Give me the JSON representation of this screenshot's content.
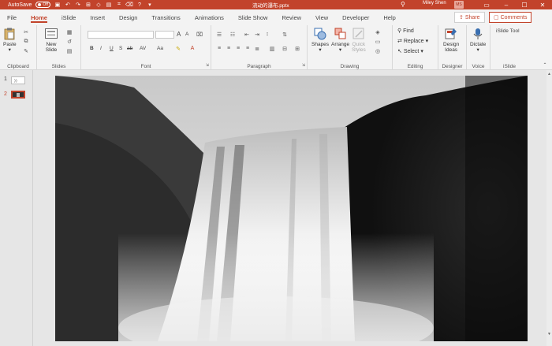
{
  "titlebar": {
    "autosave_label": "AutoSave",
    "autosave_state": "Off",
    "doc_title": "流动的瀑布.pptx",
    "user_name": "Miley Shen",
    "user_initials": "MS"
  },
  "tabs": [
    {
      "label": "File"
    },
    {
      "label": "Home"
    },
    {
      "label": "iSlide"
    },
    {
      "label": "Insert"
    },
    {
      "label": "Design"
    },
    {
      "label": "Transitions"
    },
    {
      "label": "Animations"
    },
    {
      "label": "Slide Show"
    },
    {
      "label": "Review"
    },
    {
      "label": "View"
    },
    {
      "label": "Developer"
    },
    {
      "label": "Help"
    }
  ],
  "active_tab": "Home",
  "share_label": "Share",
  "comments_label": "Comments",
  "ribbon": {
    "clipboard": {
      "label": "Clipboard",
      "paste": "Paste"
    },
    "slides": {
      "label": "Slides",
      "new_slide_line1": "New",
      "new_slide_line2": "Slide"
    },
    "font": {
      "label": "Font",
      "bold": "B",
      "italic": "I",
      "underline": "U",
      "strike": "S",
      "shadow": "ab",
      "spacing": "AV",
      "case": "Aa",
      "grow": "A",
      "shrink": "A"
    },
    "paragraph": {
      "label": "Paragraph"
    },
    "drawing": {
      "label": "Drawing",
      "shapes": "Shapes",
      "arrange": "Arrange",
      "quick_styles_line1": "Quick",
      "quick_styles_line2": "Styles"
    },
    "editing": {
      "label": "Editing",
      "find": "Find",
      "replace": "Replace",
      "select": "Select"
    },
    "designer": {
      "label": "Designer",
      "design_ideas_line1": "Design",
      "design_ideas_line2": "Ideas"
    },
    "voice": {
      "label": "Voice",
      "dictate": "Dictate"
    },
    "islide": {
      "label": "iSlide",
      "tool": "iSlide Tool"
    }
  },
  "slides": [
    {
      "number": "1"
    },
    {
      "number": "2"
    }
  ],
  "colors": {
    "accent": "#c2432b",
    "ribbon_bg": "#f3f3f3",
    "pane_bg": "#e6e6e6"
  }
}
